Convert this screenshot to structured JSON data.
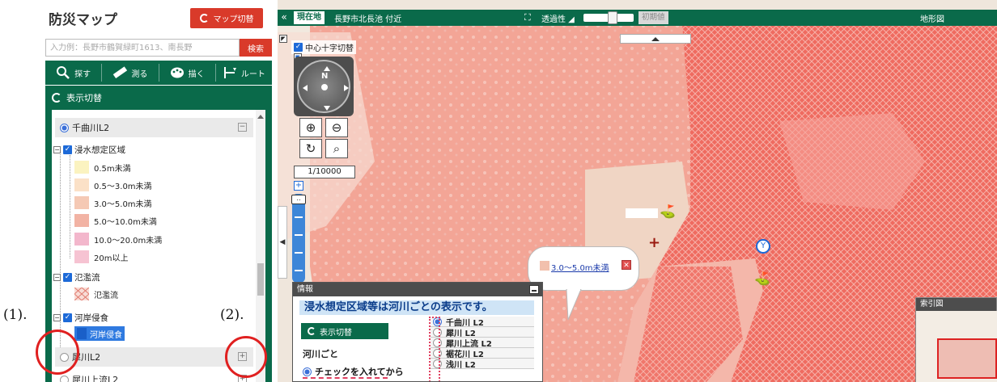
{
  "sidebar": {
    "title": "防災マップ",
    "map_switch_label": "マップ切替",
    "search": {
      "placeholder": "入力例：長野市鶴賀緑町1613、南長野",
      "button_label": "検索"
    },
    "toolbar": [
      {
        "label": "探す",
        "icon": "search-icon"
      },
      {
        "label": "測る",
        "icon": "ruler-icon"
      },
      {
        "label": "描く",
        "icon": "palette-icon"
      },
      {
        "label": "ルート",
        "icon": "route-icon"
      }
    ],
    "display_toggle_label": "表示切替",
    "layers": {
      "group1_label": "千曲川L2",
      "group1_selected": true,
      "inundation_label": "浸水想定区域",
      "legend": [
        {
          "label": "0.5m未満",
          "color": "#fbf3c0"
        },
        {
          "label": "0.5～3.0m未満",
          "color": "#fbe1c7"
        },
        {
          "label": "3.0～5.0m未満",
          "color": "#f5c9b4"
        },
        {
          "label": "5.0～10.0m未満",
          "color": "#f2b3a4"
        },
        {
          "label": "10.0～20.0m未満",
          "color": "#f3b7cc"
        },
        {
          "label": "20m以上",
          "color": "#f6c3d2"
        }
      ],
      "flood_flow_label": "氾濫流",
      "flood_flow_item": "氾濫流",
      "erosion_label": "河岸侵食",
      "erosion_item": "河岸侵食",
      "group2_label": "犀川L2",
      "group3_label": "犀川上流L2"
    }
  },
  "annotations": {
    "label1": "(1).",
    "label2": "(2)."
  },
  "map": {
    "current_location_label": "現在地",
    "current_location_text": "長野市北長池 付近",
    "transparency_label": "透過性",
    "transparency_level": 0.6,
    "initial_value_label": "初期値",
    "basemap_label": "地形図",
    "center_cross_label": "中心十字切替",
    "compass_north": "N",
    "scale": "1/10000",
    "popup_label": "3.0～5.0m未満",
    "info": {
      "header": "情報",
      "banner": "浸水想定区域等は河川ごとの表示です。",
      "toggle_label": "表示切替",
      "text1": "河川ごと",
      "text2": "チェックを入れてから",
      "rivers": [
        "千曲川 L2",
        "犀川 L2",
        "犀川上流 L2",
        "裾花川 L2",
        "浅川 L2"
      ]
    },
    "index_map_label": "索引図",
    "colors": {
      "hazard_red": "#e8574d",
      "hazard_pink": "#f3a596",
      "panel_green": "#0a6a4a",
      "accent_red": "#d93a2a"
    }
  }
}
